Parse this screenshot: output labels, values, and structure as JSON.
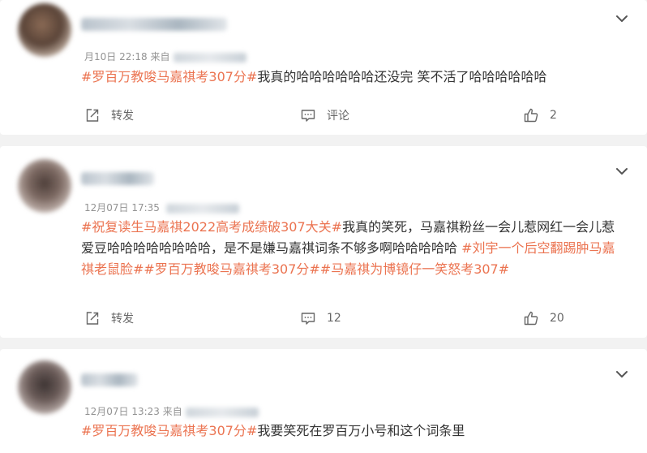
{
  "posts": [
    {
      "meta_date": "月10日 22:18",
      "meta_from": "来自",
      "segments": [
        {
          "type": "tag",
          "text": "#罗百万教唆马嘉祺考307分#"
        },
        {
          "type": "text",
          "text": "我真的哈哈哈哈哈哈还没完 笑不活了哈哈哈哈哈哈"
        }
      ],
      "actions": {
        "repost": "转发",
        "comment": "评论",
        "like": "2"
      }
    },
    {
      "meta_date": "12月07日 17:35",
      "meta_from": "",
      "segments": [
        {
          "type": "tag",
          "text": "#祝复读生马嘉祺2022高考成绩破307大关#"
        },
        {
          "type": "text",
          "text": "我真的笑死，马嘉祺粉丝一会儿惹网红一会儿惹爱豆哈哈哈哈哈哈哈哈，是不是嫌马嘉祺词条不够多啊哈哈哈哈哈 "
        },
        {
          "type": "tag",
          "text": "#刘宇一个后空翻踢肿马嘉祺老鼠脸#"
        },
        {
          "type": "tag",
          "text": "#罗百万教唆马嘉祺考307分#"
        },
        {
          "type": "tag",
          "text": "#马嘉祺为博镜仔一笑怒考307#"
        }
      ],
      "actions": {
        "repost": "转发",
        "comment": "12",
        "like": "20"
      }
    },
    {
      "meta_date": "12月07日 13:23",
      "meta_from": "来自",
      "segments": [
        {
          "type": "tag",
          "text": "#罗百万教唆马嘉祺考307分#"
        },
        {
          "type": "text",
          "text": "我要笑死在罗百万小号和这个词条里"
        }
      ]
    }
  ],
  "icons": {
    "more": "chevron-down-icon",
    "repost": "share-icon",
    "comment": "comment-icon",
    "like": "thumbs-up-icon"
  },
  "colors": {
    "tag": "#eb7350",
    "meta": "#939393",
    "text": "#333333",
    "background": "#f2f2f2"
  }
}
